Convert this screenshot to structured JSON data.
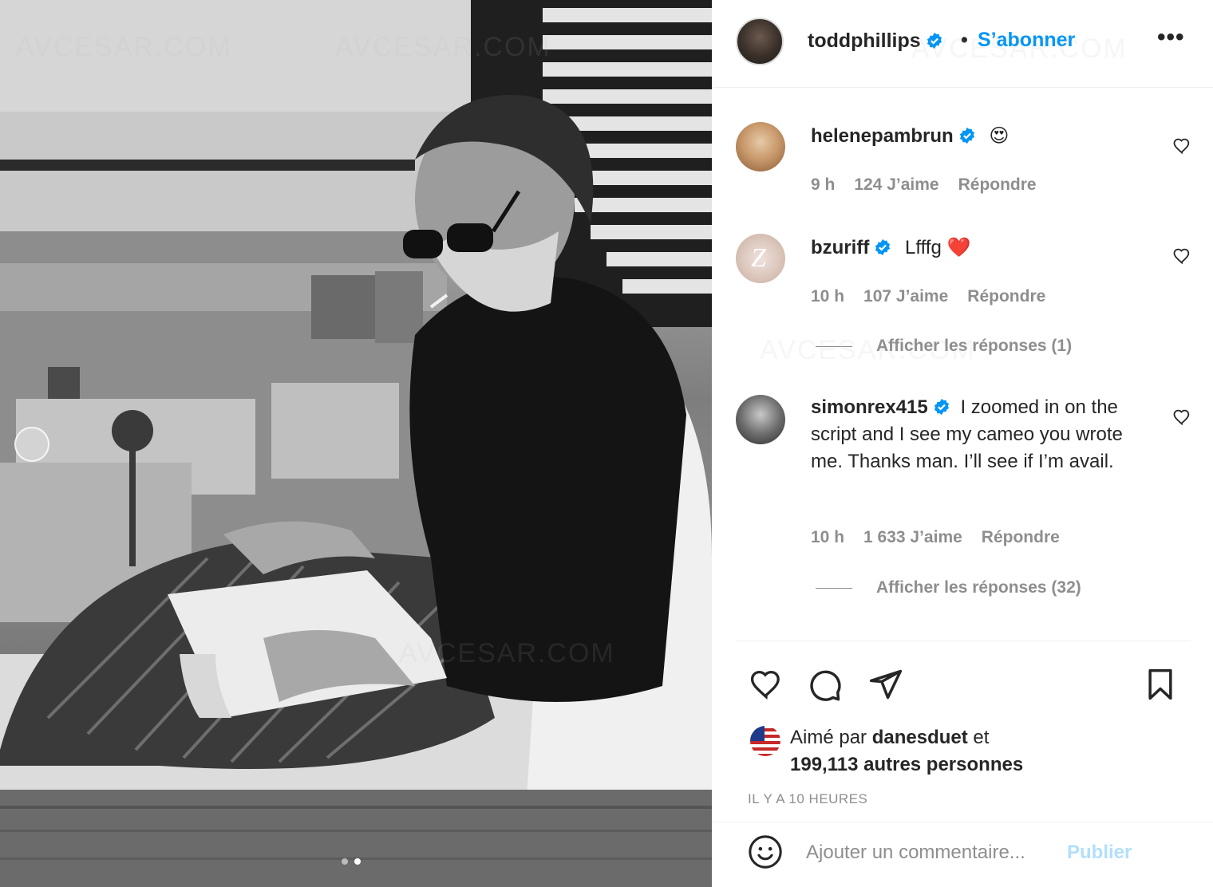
{
  "post": {
    "author": "toddphillips",
    "separator": "•",
    "follow_label": "S’abonner",
    "more_label": "•••"
  },
  "comments": [
    {
      "username": "helenepambrun",
      "text": "😍",
      "time": "9 h",
      "likes": "124 J’aime",
      "reply_label": "Répondre"
    },
    {
      "username": "bzuriff",
      "text": "Lfffg ❤️",
      "time": "10 h",
      "likes": "107 J’aime",
      "reply_label": "Répondre",
      "replies_label": "Afficher les réponses (1)"
    },
    {
      "username": "simonrex415",
      "text": "I zoomed in on the script and I see my cameo you wrote me. Thanks man. I’ll see if I’m avail.",
      "time": "10 h",
      "likes": "1 633 J’aime",
      "reply_label": "Répondre",
      "replies_label": "Afficher les réponses (32)"
    }
  ],
  "likes": {
    "prefix": "Aimé par",
    "user": "danesduet",
    "joiner": "et",
    "others": "199,113 autres personnes"
  },
  "timestamp": "IL Y A 10 HEURES",
  "composer": {
    "placeholder": "Ajouter un commentaire...",
    "publish_label": "Publier"
  },
  "watermark": "AVCESAR.COM",
  "colors": {
    "accent": "#0095f6",
    "publish_disabled": "#b2dffc",
    "muted": "#8e8e8e",
    "heart_red": "#ed4956"
  },
  "icons": [
    "verified-icon",
    "heart-icon",
    "comment-icon",
    "share-icon",
    "bookmark-icon",
    "emoji-icon"
  ]
}
